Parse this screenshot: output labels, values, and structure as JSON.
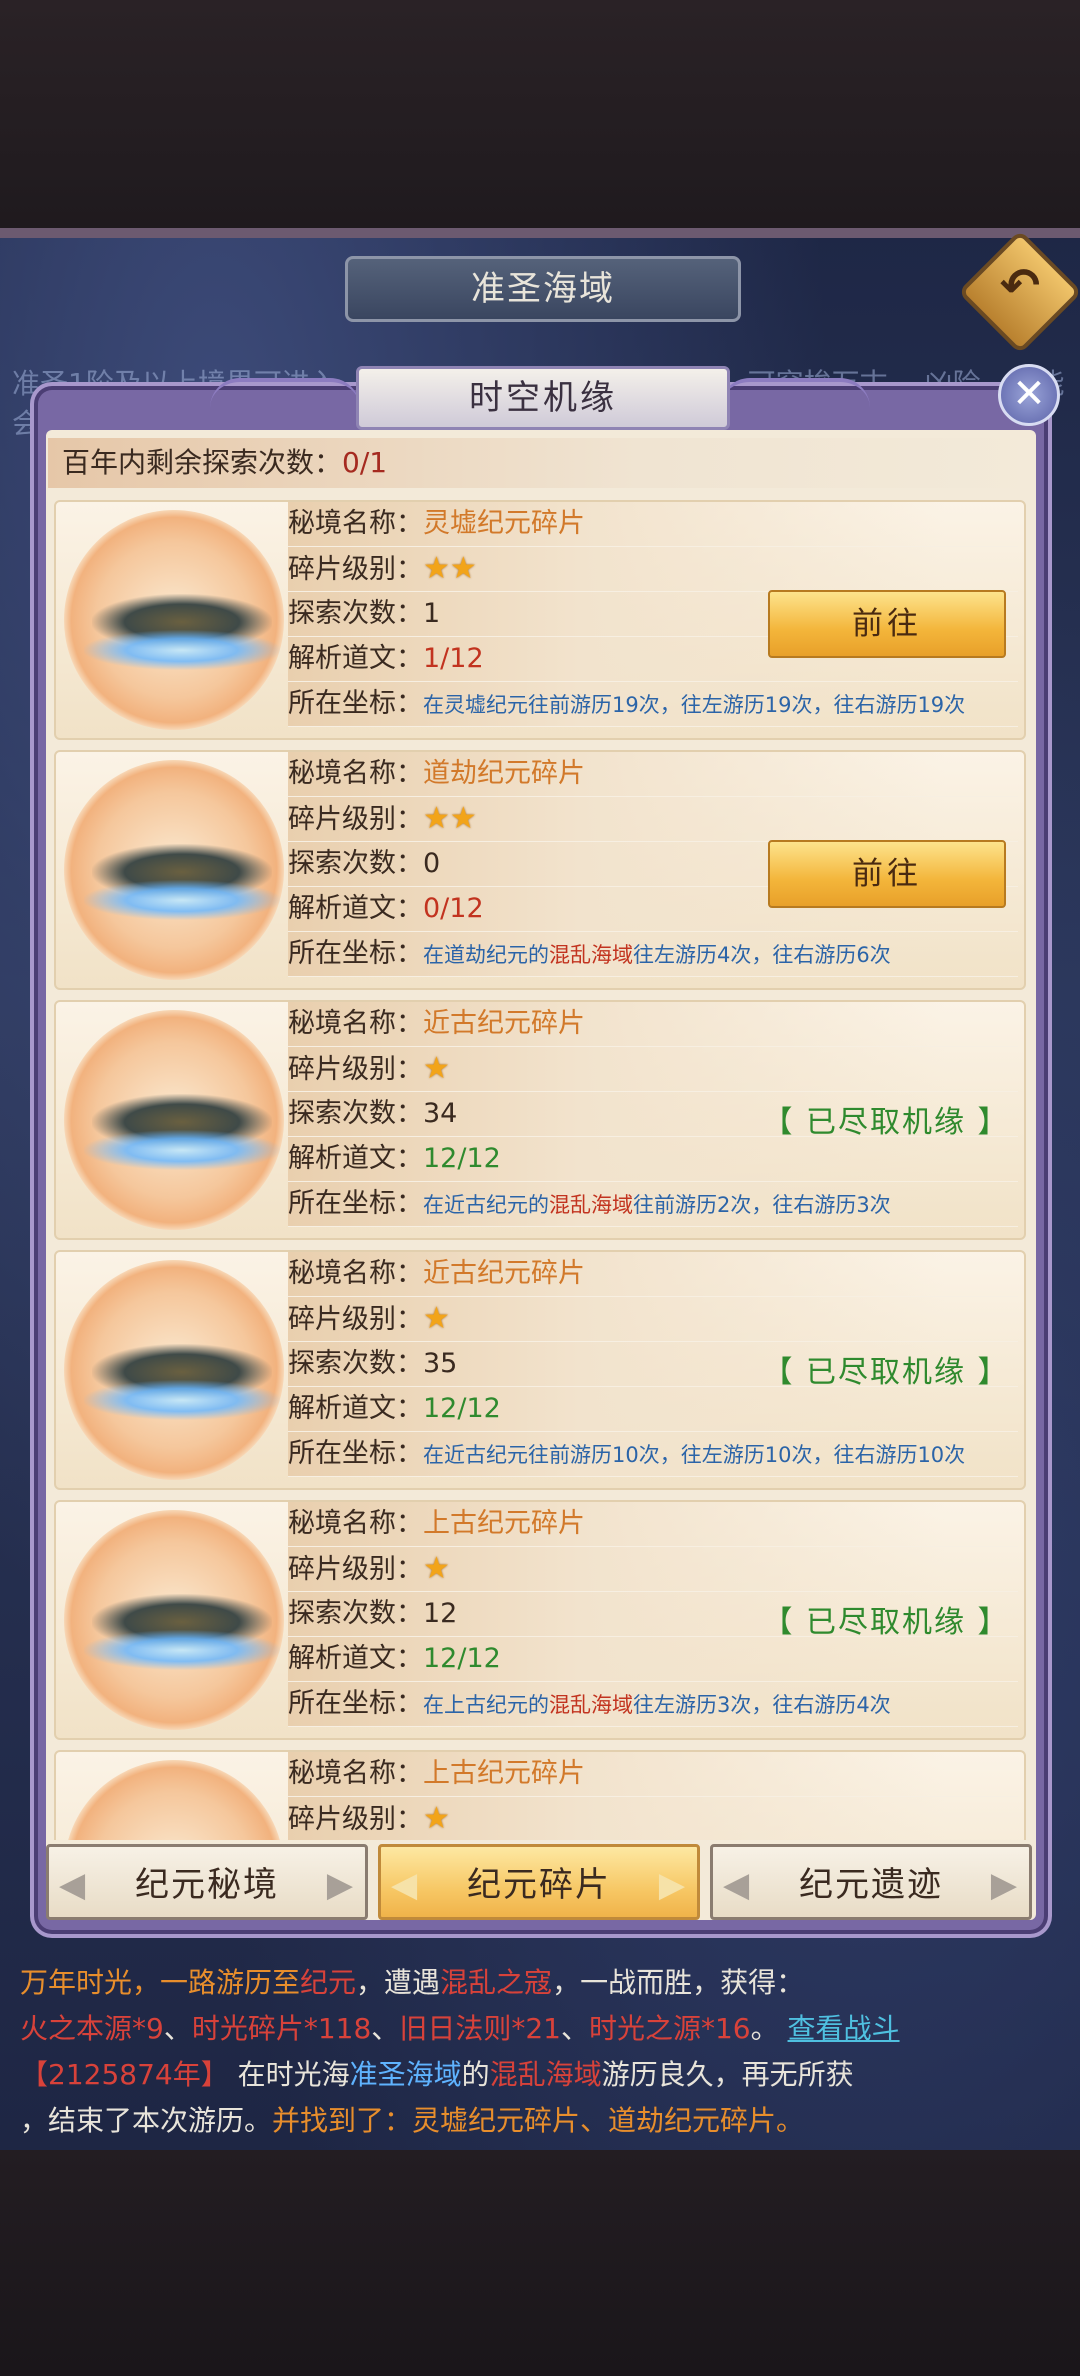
{
  "scene": {
    "header_title": "准圣海域",
    "bg_hint": "准圣1阶及以上境界可进入… 每个纪元百万年… 海中游历，可穿梭万古… 凶险，可能会遭遇…",
    "log": {
      "l1a": "万年时光，一路游历至",
      "l1b": "，遭遇",
      "l1c": "，一战而胜，获得：",
      "l2a": "火之本源*9",
      "l2b": "、",
      "l2c": "时光碎片*118",
      "l2d": "、",
      "l2e": "旧日法则*21",
      "l2f": "、",
      "l2g": "时光之源*16",
      "l2h": "。",
      "l2link": "查看战斗",
      "l3a": "【2125874年】",
      "l3b": "在时光海",
      "l3c": "准圣海域",
      "l3d": "的",
      "l3e": "游历良久，再无所获",
      "l4a": "，结束了本次游历。",
      "l4b": "并找到了：灵墟纪元碎片、道劫纪元碎片。"
    }
  },
  "dialog": {
    "title": "时空机缘",
    "close_glyph": "✕",
    "remaining_label": "百年内剩余探索次数：",
    "remaining_value": "0/1"
  },
  "labels": {
    "name": "秘境名称：",
    "level": "碎片级别：",
    "explore": "探索次数：",
    "decode": "解析道文：",
    "coord": "所在坐标："
  },
  "cards": [
    {
      "name": "灵墟纪元碎片",
      "stars": "★★",
      "explore": "1",
      "decode": "1/12",
      "decode_status": "red",
      "coord_a": "在灵墟纪元往前游历19次，往左游历19次，往右游历19次",
      "coord_hl": "",
      "coord_b": "",
      "action": "前往"
    },
    {
      "name": "道劫纪元碎片",
      "stars": "★★",
      "explore": "0",
      "decode": "0/12",
      "decode_status": "red",
      "coord_a": "在道劫纪元的",
      "coord_hl": "混乱海域",
      "coord_b": "往左游历4次，往右游历6次",
      "action": "前往"
    },
    {
      "name": "近古纪元碎片",
      "stars": "★",
      "explore": "34",
      "decode": "12/12",
      "decode_status": "green",
      "coord_a": "在近古纪元的",
      "coord_hl": "混乱海域",
      "coord_b": "往前游历2次，往右游历3次",
      "done": "【 已尽取机缘 】"
    },
    {
      "name": "近古纪元碎片",
      "stars": "★",
      "explore": "35",
      "decode": "12/12",
      "decode_status": "green",
      "coord_a": "在近古纪元往前游历10次，往左游历10次，往右游历10次",
      "coord_hl": "",
      "coord_b": "",
      "done": "【 已尽取机缘 】"
    },
    {
      "name": "上古纪元碎片",
      "stars": "★",
      "explore": "12",
      "decode": "12/12",
      "decode_status": "green",
      "coord_a": "在上古纪元的",
      "coord_hl": "混乱海域",
      "coord_b": "往左游历3次，往右游历4次",
      "done": "【 已尽取机缘 】"
    },
    {
      "name": "上古纪元碎片",
      "stars": "★"
    }
  ],
  "tabs": [
    {
      "label": "纪元秘境",
      "active": false
    },
    {
      "label": "纪元碎片",
      "active": true
    },
    {
      "label": "纪元遗迹",
      "active": false
    }
  ],
  "icons": {
    "back": "back-arrow-icon",
    "close": "close-icon",
    "star": "star-icon",
    "tab_chevron": "chevron-icon"
  },
  "colors": {
    "name_orange": "#d2792a",
    "red": "#c2331f",
    "green": "#2f8a2e",
    "coord_blue": "#2b64a8",
    "gold_button": "#f3b53a"
  }
}
